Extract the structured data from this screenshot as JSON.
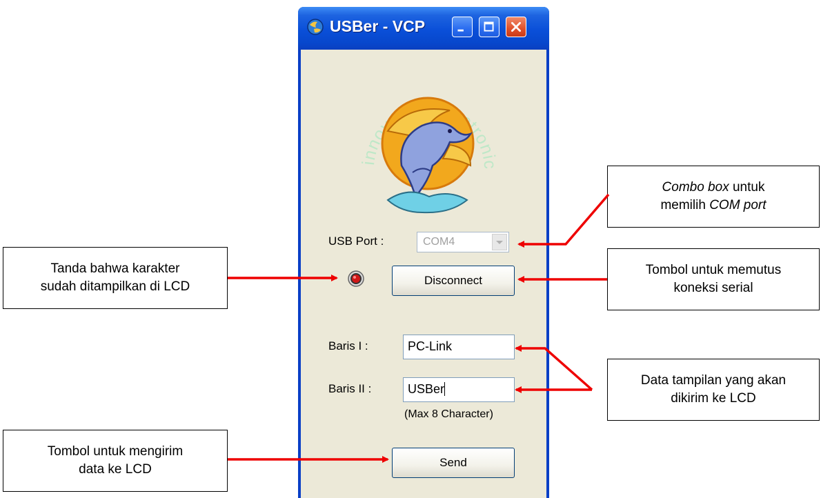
{
  "window": {
    "title": "USBer - VCP"
  },
  "logo": {
    "text": "innovative electronics"
  },
  "form": {
    "usb_port_label": "USB Port :",
    "usb_port_value": "COM4",
    "disconnect_label": "Disconnect",
    "line1_label": "Baris I  :",
    "line1_value": "PC-Link",
    "line2_label": "Baris II :",
    "line2_value": "USBer",
    "max_note": "(Max 8 Character)",
    "send_label": "Send"
  },
  "callouts": {
    "combo": {
      "italic1": "Combo box",
      "text1": " untuk",
      "text2": "memilih ",
      "italic2": "COM port"
    },
    "led": {
      "line1": "Tanda bahwa karakter",
      "line2": "sudah ditampilkan di LCD"
    },
    "disconnect": {
      "line1": "Tombol untuk memutus",
      "line2": "koneksi serial"
    },
    "data": {
      "line1": "Data tampilan yang akan",
      "line2": "dikirim ke LCD"
    },
    "send": {
      "line1": "Tombol untuk mengirim",
      "line2": "data ke LCD"
    }
  },
  "colors": {
    "arrow": "#ee0000",
    "titlebar": "#0a4fd8",
    "window_bg": "#ece9d8"
  }
}
